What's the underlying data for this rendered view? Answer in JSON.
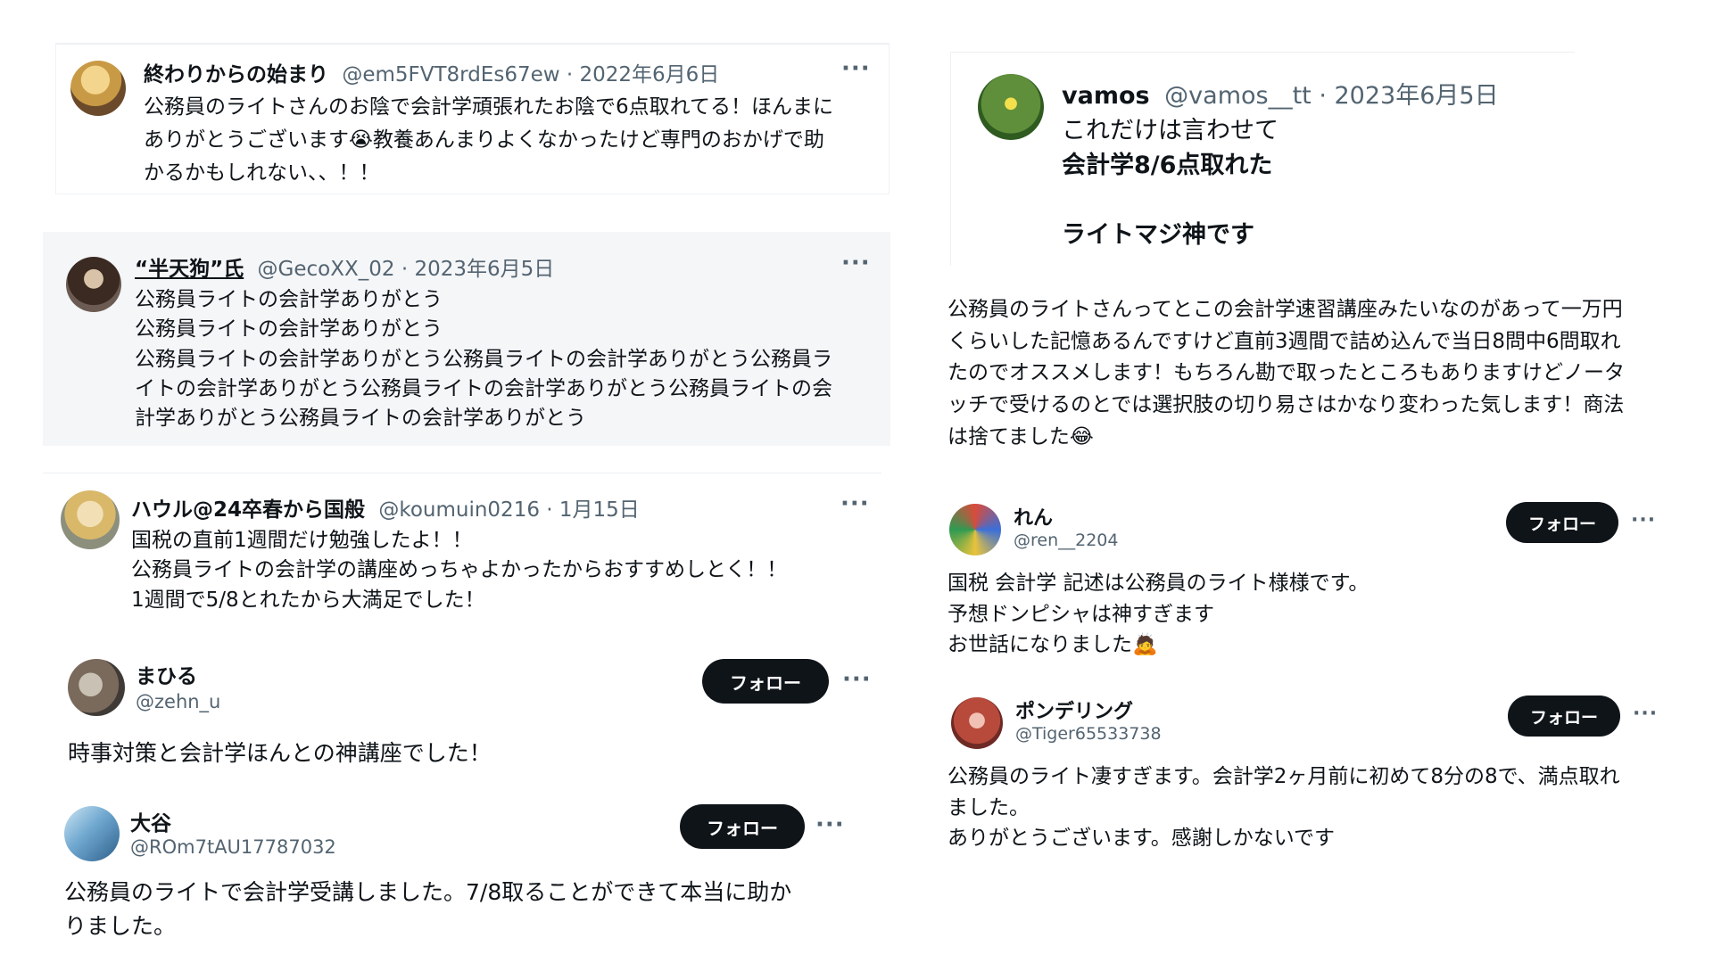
{
  "left": {
    "t1": {
      "name": "終わりからの始まり",
      "meta": "@em5FVT8rdEs67ew · 2022年6月6日",
      "lines": [
        "公務員のライトさんのお陰で会計学頑張れたお陰で6点取れてる！ほんまに",
        "ありがとうございます😭教養あんまりよくなかったけど専門のおかげで助",
        "かるかもしれない、、！！"
      ]
    },
    "t2": {
      "name": "“半天狗”氏",
      "meta": "@GecoXX_02 · 2023年6月5日",
      "lines": [
        "公務員ライトの会計学ありがとう",
        "公務員ライトの会計学ありがとう",
        "公務員ライトの会計学ありがとう公務員ライトの会計学ありがとう公務員ラ",
        "イトの会計学ありがとう公務員ライトの会計学ありがとう公務員ライトの会",
        "計学ありがとう公務員ライトの会計学ありがとう"
      ]
    },
    "t3": {
      "name": "ハウル@24卒春から国般",
      "meta": "@koumuin0216 · 1月15日",
      "lines": [
        "国税の直前1週間だけ勉強したよ！！",
        "公務員ライトの会計学の講座めっちゃよかったからおすすめしとく！！",
        "1週間で5/8とれたから大満足でした！"
      ]
    },
    "t4": {
      "name": "まひる",
      "handle": "@zehn_u",
      "follow": "フォロー",
      "text": "時事対策と会計学ほんとの神講座でした！"
    },
    "t5": {
      "name": "大谷",
      "handle": "@ROm7tAU17787032",
      "follow": "フォロー",
      "lines": [
        "公務員のライトで会計学受講しました。7/8取ることができて本当に助か",
        "りました。"
      ]
    }
  },
  "right": {
    "t6": {
      "name": "vamos",
      "meta": "@vamos__tt · 2023年6月5日",
      "lines": [
        "これだけは言わせて",
        "会計学8/6点取れた",
        "",
        "ライトマジ神です"
      ]
    },
    "t7": {
      "lines": [
        "公務員のライトさんってとこの会計学速習講座みたいなのがあって一万円",
        "くらいした記憶あるんですけど直前3週間で詰め込んで当日8問中6問取れ",
        "たのでオススメします！もちろん勘で取ったところもありますけどノータ",
        "ッチで受けるのとでは選択肢の切り易さはかなり変わった気します！商法",
        "は捨てました😂"
      ]
    },
    "t8": {
      "name": "れん",
      "handle": "@ren__2204",
      "follow": "フォロー",
      "lines": [
        "国税 会計学 記述は公務員のライト様様です。",
        "予想ドンピシャは神すぎます",
        "お世話になりました🙇"
      ]
    },
    "t9": {
      "name": "ポンデリング",
      "handle": "@Tiger65533738",
      "follow": "フォロー",
      "lines": [
        "公務員のライト凄すぎます。会計学2ヶ月前に初めて8分の8で、満点取れ",
        "ました。",
        "ありがとうございます。感謝しかないです"
      ]
    }
  },
  "more_label": "···",
  "icons": [
    "avatar",
    "more-icon"
  ]
}
